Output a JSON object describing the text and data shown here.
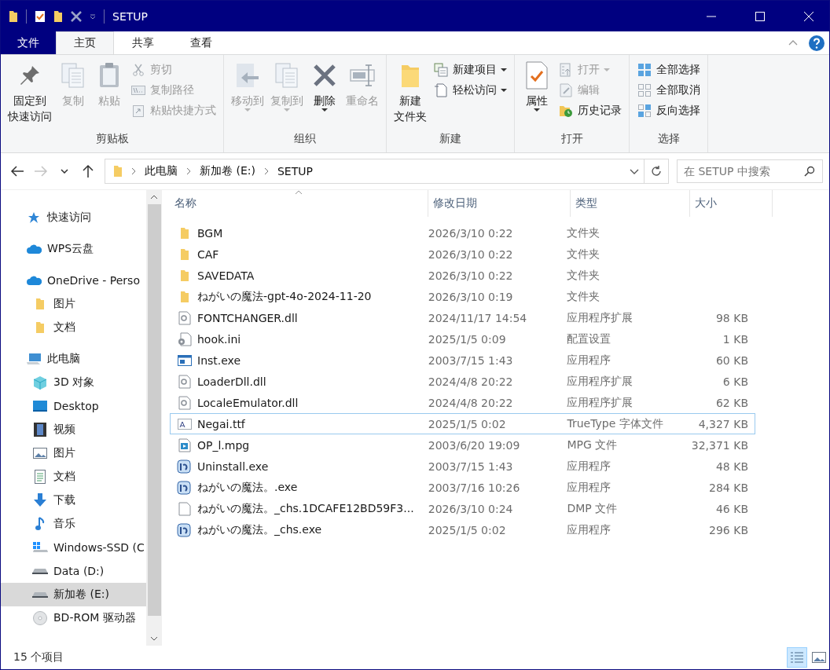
{
  "window": {
    "title": "SETUP"
  },
  "ribbon_tabs": [
    {
      "label": "文件",
      "kind": "file",
      "selected": false
    },
    {
      "label": "主页",
      "kind": "tab",
      "selected": true
    },
    {
      "label": "共享",
      "kind": "tab",
      "selected": false
    },
    {
      "label": "查看",
      "kind": "tab",
      "selected": false
    }
  ],
  "ribbon_groups": [
    {
      "label": "剪贴板",
      "items": [
        {
          "kind": "large",
          "label": [
            "固定到",
            "快速访问"
          ],
          "disabled": false,
          "dropdown": false
        },
        {
          "kind": "large",
          "label": [
            "复制"
          ],
          "disabled": true,
          "dropdown": false
        },
        {
          "kind": "large",
          "label": [
            "粘贴"
          ],
          "disabled": true,
          "dropdown": false
        },
        {
          "kind": "stack",
          "items": [
            {
              "label": "剪切",
              "disabled": true,
              "dropdown": false
            },
            {
              "label": "复制路径",
              "disabled": true,
              "dropdown": false
            },
            {
              "label": "粘贴快捷方式",
              "disabled": true,
              "dropdown": false
            }
          ]
        }
      ]
    },
    {
      "label": "组织",
      "items": [
        {
          "kind": "large",
          "label": [
            "移动到"
          ],
          "disabled": true,
          "dropdown": true
        },
        {
          "kind": "large",
          "label": [
            "复制到"
          ],
          "disabled": true,
          "dropdown": true
        },
        {
          "kind": "large",
          "label": [
            "删除"
          ],
          "disabled": false,
          "dropdown": true
        },
        {
          "kind": "large",
          "label": [
            "重命名"
          ],
          "disabled": true,
          "dropdown": false
        }
      ]
    },
    {
      "label": "新建",
      "items": [
        {
          "kind": "large",
          "label": [
            "新建",
            "文件夹"
          ],
          "disabled": false,
          "dropdown": false
        },
        {
          "kind": "stack",
          "items": [
            {
              "label": "新建项目",
              "disabled": false,
              "dropdown": true
            },
            {
              "label": "轻松访问",
              "disabled": false,
              "dropdown": true
            }
          ]
        }
      ]
    },
    {
      "label": "打开",
      "items": [
        {
          "kind": "large",
          "label": [
            "属性"
          ],
          "disabled": false,
          "dropdown": true
        },
        {
          "kind": "stack",
          "items": [
            {
              "label": "打开",
              "disabled": true,
              "dropdown": true
            },
            {
              "label": "编辑",
              "disabled": true,
              "dropdown": false
            },
            {
              "label": "历史记录",
              "disabled": false,
              "dropdown": false
            }
          ]
        }
      ]
    },
    {
      "label": "选择",
      "items": [
        {
          "kind": "stack",
          "items": [
            {
              "label": "全部选择",
              "disabled": false,
              "dropdown": false
            },
            {
              "label": "全部取消",
              "disabled": false,
              "dropdown": false
            },
            {
              "label": "反向选择",
              "disabled": false,
              "dropdown": false
            }
          ]
        }
      ]
    }
  ],
  "nav_buttons": [
    {
      "kind": "back",
      "disabled": false
    },
    {
      "kind": "forward",
      "disabled": true
    },
    {
      "kind": "recent",
      "disabled": false
    },
    {
      "kind": "up",
      "disabled": false
    }
  ],
  "breadcrumb": [
    "此电脑",
    "新加卷 (E:)",
    "SETUP"
  ],
  "search": {
    "placeholder": "在 SETUP 中搜索"
  },
  "sidebar": {
    "items": [
      {
        "label": "快速访问",
        "kind": "star",
        "selected": false
      },
      {
        "label": "WPS云盘",
        "kind": "cloud",
        "selected": false
      },
      {
        "label": "OneDrive - Perso",
        "kind": "cloud",
        "selected": false,
        "children": [
          {
            "label": "图片",
            "kind": "folder",
            "selected": false
          },
          {
            "label": "文档",
            "kind": "folder",
            "selected": false
          }
        ]
      },
      {
        "label": "此电脑",
        "kind": "pc",
        "selected": false,
        "children": [
          {
            "label": "3D 对象",
            "kind": "cube",
            "selected": false
          },
          {
            "label": "Desktop",
            "kind": "desktop",
            "selected": false
          },
          {
            "label": "视频",
            "kind": "video",
            "selected": false
          },
          {
            "label": "图片",
            "kind": "picture",
            "selected": false
          },
          {
            "label": "文档",
            "kind": "document",
            "selected": false
          },
          {
            "label": "下载",
            "kind": "download",
            "selected": false
          },
          {
            "label": "音乐",
            "kind": "music",
            "selected": false
          },
          {
            "label": "Windows-SSD (C",
            "kind": "system-drive",
            "selected": false
          },
          {
            "label": "Data (D:)",
            "kind": "drive",
            "selected": false
          },
          {
            "label": "新加卷 (E:)",
            "kind": "drive",
            "selected": true
          },
          {
            "label": "BD-ROM 驱动器",
            "kind": "disc",
            "selected": false
          }
        ]
      }
    ]
  },
  "table": {
    "columns": [
      {
        "label": "名称",
        "sorted": true
      },
      {
        "label": "修改日期",
        "sorted": false
      },
      {
        "label": "类型",
        "sorted": false
      },
      {
        "label": "大小",
        "sorted": false
      }
    ],
    "rows": [
      {
        "kind": "folder",
        "name": "BGM",
        "date": "2026/3/10 0:22",
        "type": "文件夹",
        "size": "",
        "hovered": false
      },
      {
        "kind": "folder",
        "name": "CAF",
        "date": "2026/3/10 0:22",
        "type": "文件夹",
        "size": "",
        "hovered": false
      },
      {
        "kind": "folder",
        "name": "SAVEDATA",
        "date": "2026/3/10 0:22",
        "type": "文件夹",
        "size": "",
        "hovered": false
      },
      {
        "kind": "folder",
        "name": "ねがいの魔法-gpt-4o-2024-11-20",
        "date": "2026/3/10 0:19",
        "type": "文件夹",
        "size": "",
        "hovered": false
      },
      {
        "kind": "library",
        "name": "FONTCHANGER.dll",
        "date": "2024/11/17 14:54",
        "type": "应用程序扩展",
        "size": "98 KB",
        "hovered": false
      },
      {
        "kind": "settings",
        "name": "hook.ini",
        "date": "2025/1/5 0:09",
        "type": "配置设置",
        "size": "1 KB",
        "hovered": false
      },
      {
        "kind": "window",
        "name": "Inst.exe",
        "date": "2003/7/15 1:43",
        "type": "应用程序",
        "size": "60 KB",
        "hovered": false
      },
      {
        "kind": "library",
        "name": "LoaderDll.dll",
        "date": "2024/4/8 20:22",
        "type": "应用程序扩展",
        "size": "6 KB",
        "hovered": false
      },
      {
        "kind": "library",
        "name": "LocaleEmulator.dll",
        "date": "2024/4/8 20:22",
        "type": "应用程序扩展",
        "size": "62 KB",
        "hovered": false
      },
      {
        "kind": "font",
        "name": "Negai.ttf",
        "date": "2025/1/5 0:02",
        "type": "TrueType 字体文件",
        "size": "4,327 KB",
        "hovered": true
      },
      {
        "kind": "media",
        "name": "OP_l.mpg",
        "date": "2003/6/20 19:09",
        "type": "MPG 文件",
        "size": "32,371 KB",
        "hovered": false
      },
      {
        "kind": "app",
        "name": "Uninstall.exe",
        "date": "2003/7/15 1:43",
        "type": "应用程序",
        "size": "48 KB",
        "hovered": false
      },
      {
        "kind": "app",
        "name": "ねがいの魔法。.exe",
        "date": "2003/7/16 10:26",
        "type": "应用程序",
        "size": "284 KB",
        "hovered": false
      },
      {
        "kind": "blank",
        "name": "ねがいの魔法。_chs.1DCAFE12BD59F3...",
        "date": "2026/3/10 0:24",
        "type": "DMP 文件",
        "size": "46 KB",
        "hovered": false
      },
      {
        "kind": "app",
        "name": "ねがいの魔法。_chs.exe",
        "date": "2025/1/5 0:02",
        "type": "应用程序",
        "size": "296 KB",
        "hovered": false
      }
    ]
  },
  "status_bar": {
    "count": "15 个项目"
  },
  "view_buttons": [
    {
      "kind": "details",
      "selected": true
    },
    {
      "kind": "large-icons",
      "selected": false
    }
  ]
}
